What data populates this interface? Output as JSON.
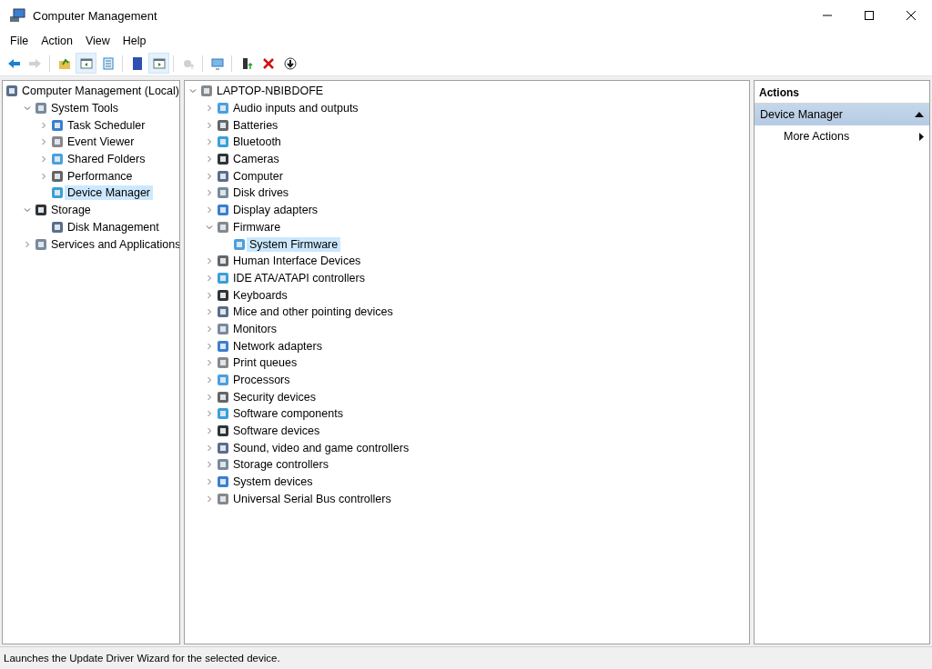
{
  "window": {
    "title": "Computer Management"
  },
  "menu": [
    "File",
    "Action",
    "View",
    "Help"
  ],
  "toolbar": [
    {
      "pressed": false,
      "disabled": false
    },
    {
      "pressed": false,
      "disabled": true
    },
    {
      "pressed": false,
      "disabled": false
    },
    {
      "pressed": true,
      "disabled": false
    },
    {
      "pressed": false,
      "disabled": false
    },
    {
      "pressed": false,
      "disabled": false
    },
    {
      "pressed": true,
      "disabled": false
    },
    {
      "pressed": false,
      "disabled": true
    },
    {
      "pressed": false,
      "disabled": false
    },
    {
      "pressed": false,
      "disabled": false
    },
    {
      "pressed": false,
      "disabled": false
    },
    {
      "pressed": false,
      "disabled": false
    }
  ],
  "console_tree": [
    {
      "label": "Computer Management (Local)",
      "selected": false,
      "children": [
        {
          "label": "System Tools",
          "expanded": true,
          "selected": false,
          "children": [
            {
              "label": "Task Scheduler",
              "expanded": false,
              "selected": false
            },
            {
              "label": "Event Viewer",
              "expanded": false,
              "selected": false
            },
            {
              "label": "Shared Folders",
              "expanded": false,
              "selected": false
            },
            {
              "label": "Performance",
              "expanded": false,
              "selected": false
            },
            {
              "label": "Device Manager",
              "selected": true
            }
          ]
        },
        {
          "label": "Storage",
          "expanded": true,
          "selected": false,
          "children": [
            {
              "label": "Disk Management",
              "selected": false
            }
          ]
        },
        {
          "label": "Services and Applications",
          "expanded": false,
          "selected": false
        }
      ]
    }
  ],
  "device_tree": [
    {
      "label": "LAPTOP-NBIBDOFE",
      "expanded": true,
      "selected": false,
      "children": [
        {
          "label": "Audio inputs and outputs",
          "expanded": false,
          "selected": false
        },
        {
          "label": "Batteries",
          "expanded": false,
          "selected": false
        },
        {
          "label": "Bluetooth",
          "expanded": false,
          "selected": false
        },
        {
          "label": "Cameras",
          "expanded": false,
          "selected": false
        },
        {
          "label": "Computer",
          "expanded": false,
          "selected": false
        },
        {
          "label": "Disk drives",
          "expanded": false,
          "selected": false
        },
        {
          "label": "Display adapters",
          "expanded": false,
          "selected": false
        },
        {
          "label": "Firmware",
          "expanded": true,
          "selected": false,
          "children": [
            {
              "label": "System Firmware",
              "selected": true
            }
          ]
        },
        {
          "label": "Human Interface Devices",
          "expanded": false,
          "selected": false
        },
        {
          "label": "IDE ATA/ATAPI controllers",
          "expanded": false,
          "selected": false
        },
        {
          "label": "Keyboards",
          "expanded": false,
          "selected": false
        },
        {
          "label": "Mice and other pointing devices",
          "expanded": false,
          "selected": false
        },
        {
          "label": "Monitors",
          "expanded": false,
          "selected": false
        },
        {
          "label": "Network adapters",
          "expanded": false,
          "selected": false
        },
        {
          "label": "Print queues",
          "expanded": false,
          "selected": false
        },
        {
          "label": "Processors",
          "expanded": false,
          "selected": false
        },
        {
          "label": "Security devices",
          "expanded": false,
          "selected": false
        },
        {
          "label": "Software components",
          "expanded": false,
          "selected": false
        },
        {
          "label": "Software devices",
          "expanded": false,
          "selected": false
        },
        {
          "label": "Sound, video and game controllers",
          "expanded": false,
          "selected": false
        },
        {
          "label": "Storage controllers",
          "expanded": false,
          "selected": false
        },
        {
          "label": "System devices",
          "expanded": false,
          "selected": false
        },
        {
          "label": "Universal Serial Bus controllers",
          "expanded": false,
          "selected": false
        }
      ]
    }
  ],
  "actions": {
    "title": "Actions",
    "sections": [
      {
        "label": "Device Manager",
        "expanded": true,
        "items": [
          "More Actions"
        ]
      }
    ]
  },
  "status_bar": "Launches the Update Driver Wizard for the selected device."
}
